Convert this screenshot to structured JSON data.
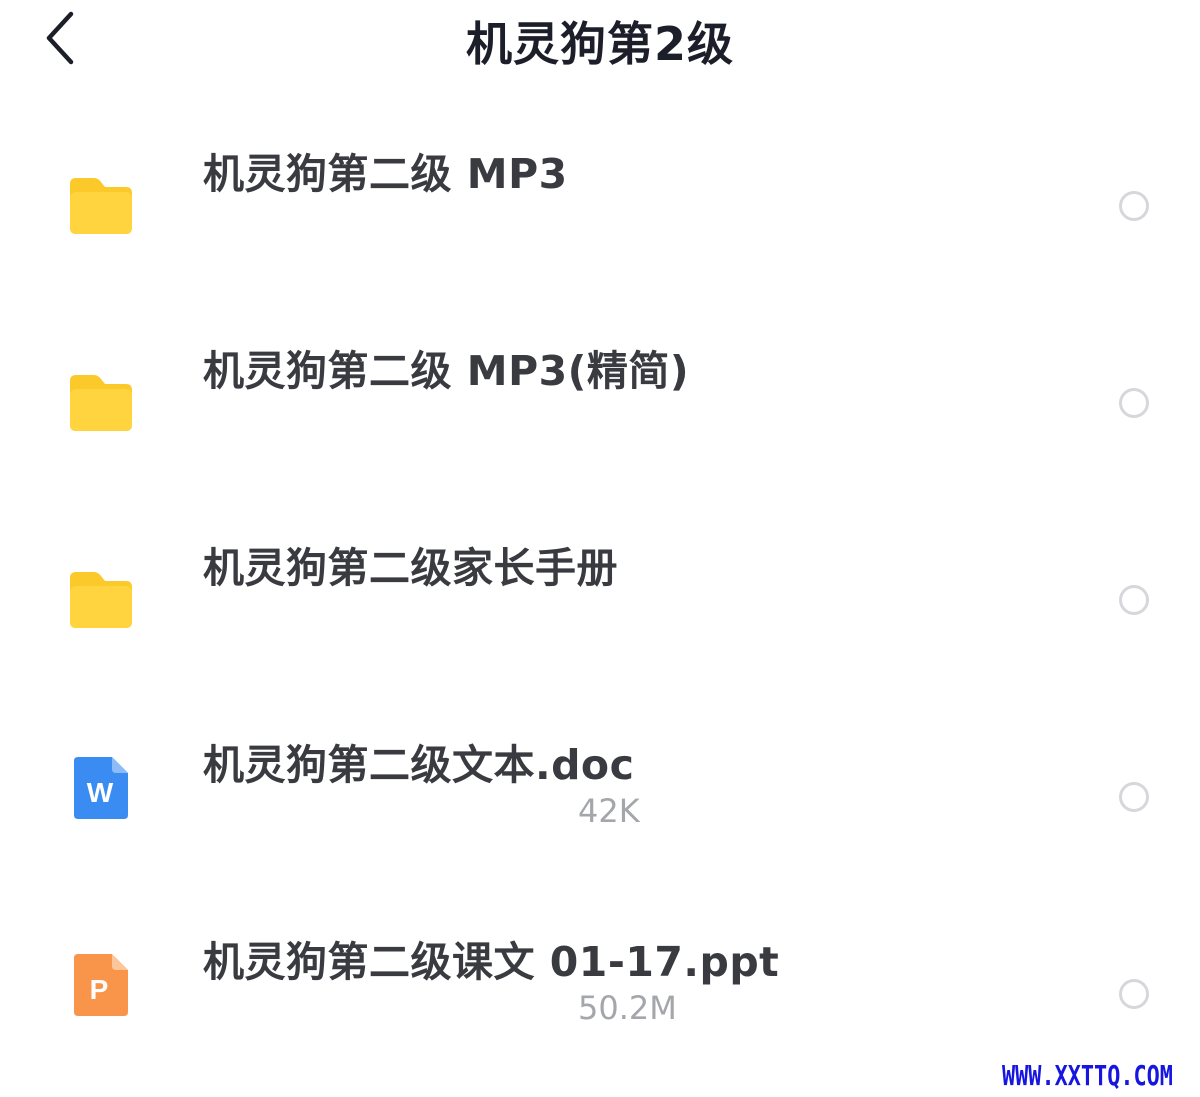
{
  "header": {
    "back_icon": "chevron-left-icon",
    "title": "机灵狗第2级"
  },
  "files": [
    {
      "name": "机灵狗第二级 MP3",
      "type": "folder",
      "icon": "folder-icon",
      "size": ""
    },
    {
      "name": "机灵狗第二级 MP3(精简)",
      "type": "folder",
      "icon": "folder-icon",
      "size": ""
    },
    {
      "name": "机灵狗第二级家长手册",
      "type": "folder",
      "icon": "folder-icon",
      "size": ""
    },
    {
      "name": "机灵狗第二级文本.doc",
      "type": "doc",
      "icon": "word-doc-icon",
      "icon_letter": "W",
      "size": "42K"
    },
    {
      "name": "机灵狗第二级课文 01-17.ppt",
      "type": "ppt",
      "icon": "powerpoint-icon",
      "icon_letter": "P",
      "size": "50.2M"
    }
  ],
  "colors": {
    "folder": "#FFD43E",
    "folder_tab": "#FCC92B",
    "word": "#3A8CF2",
    "ppt": "#F9954B",
    "radio_border": "#D6D7DA",
    "title_text": "#1C1F2A",
    "name_text": "#3A3B40",
    "size_text": "#A4A6AC",
    "watermark": "#1616E0"
  },
  "watermark": "WWW.XXTTQ.COM"
}
